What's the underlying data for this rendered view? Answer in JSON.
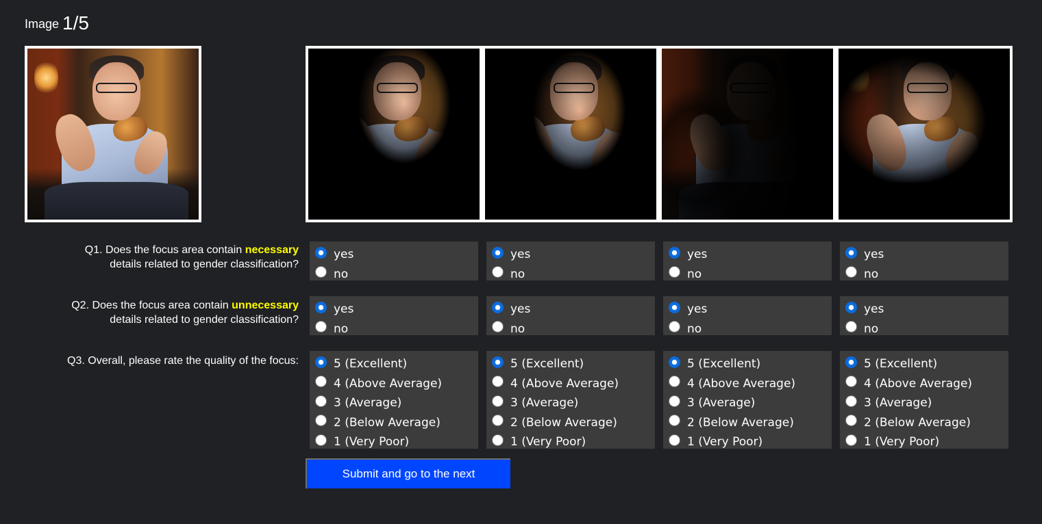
{
  "header": {
    "prefix": "Image",
    "counter": "1/5"
  },
  "questions": [
    {
      "id": "q1",
      "prefix": "Q1. Does the focus area contain ",
      "highlight": "necessary",
      "suffix": "details related to gender classification?",
      "options": [
        "yes",
        "no"
      ],
      "selected": "yes"
    },
    {
      "id": "q2",
      "prefix": "Q2. Does the focus area contain ",
      "highlight": "unnecessary",
      "suffix": "details related to gender classification?",
      "options": [
        "yes",
        "no"
      ],
      "selected": "yes"
    },
    {
      "id": "q3",
      "prefix": "Q3. Overall, please rate the quality of the focus:",
      "highlight": "",
      "suffix": "",
      "options": [
        "5 (Excellent)",
        "4 (Above Average)",
        "3 (Average)",
        "2 (Below Average)",
        "1 (Very Poor)"
      ],
      "selected": "5 (Excellent)"
    }
  ],
  "colors": {
    "highlight": "#ffff00",
    "submit": "#0046ff",
    "radio_selected": "#0b6bde",
    "panel": "#3c3c3c",
    "background": "#202124"
  },
  "submit": {
    "label": "Submit and go to the next"
  }
}
